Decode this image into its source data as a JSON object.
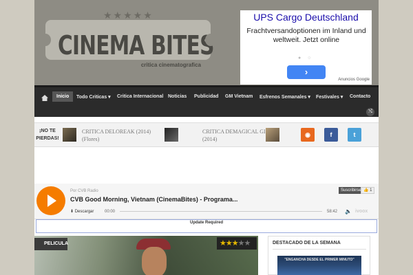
{
  "site": {
    "logo_title": "CINEMA BITES",
    "logo_stars": "★★★★★",
    "logo_subtitle": "critica cinematografica"
  },
  "ad": {
    "title": "UPS Cargo Deutschland",
    "text": "Frachtversandoptionen im Inland und weltweit. Jetzt online",
    "button_glyph": "›",
    "footer": "Anuncios Google"
  },
  "nav": {
    "items": [
      "Inicio",
      "Todo Criticas ▾",
      "Critica Internacional",
      "Noticias",
      "Publicidad",
      "GM Vietnam",
      "Esfrenos Semanales ▾",
      "Festivales ▾",
      "Contacto"
    ],
    "shuffle_glyph": "⤭"
  },
  "ticker": {
    "tag": "¡NO TE PIERDAS!",
    "items": [
      {
        "title": "CRITICA DELOREAK (2014)",
        "sub": "(Flores)"
      },
      {
        "title": "CRITICA DEMAGICAL GIRL",
        "sub": "(2014)"
      }
    ],
    "social": {
      "rss": "◉",
      "facebook": "f",
      "twitter": "t"
    }
  },
  "player": {
    "by": "Por CVB Radio",
    "title": "CVB Good Morning, Vietnam (CinemaBites) - Programa...",
    "subscribe": "Suscribirse",
    "like": "👍 1",
    "download": "⬇ Descargar",
    "time_start": "00:00",
    "time_end": "58:42",
    "volume": "🔈",
    "brand": "ivoox"
  },
  "update_notice": "Update Required",
  "featured": {
    "tag": "PELICULA",
    "rating": 3,
    "rating_max": 5
  },
  "sidebar_widget": {
    "title": "DESTACADO DE LA SEMANA",
    "image_text": "\"ENGANCHA DESDE EL PRIMER MINUTO\""
  }
}
